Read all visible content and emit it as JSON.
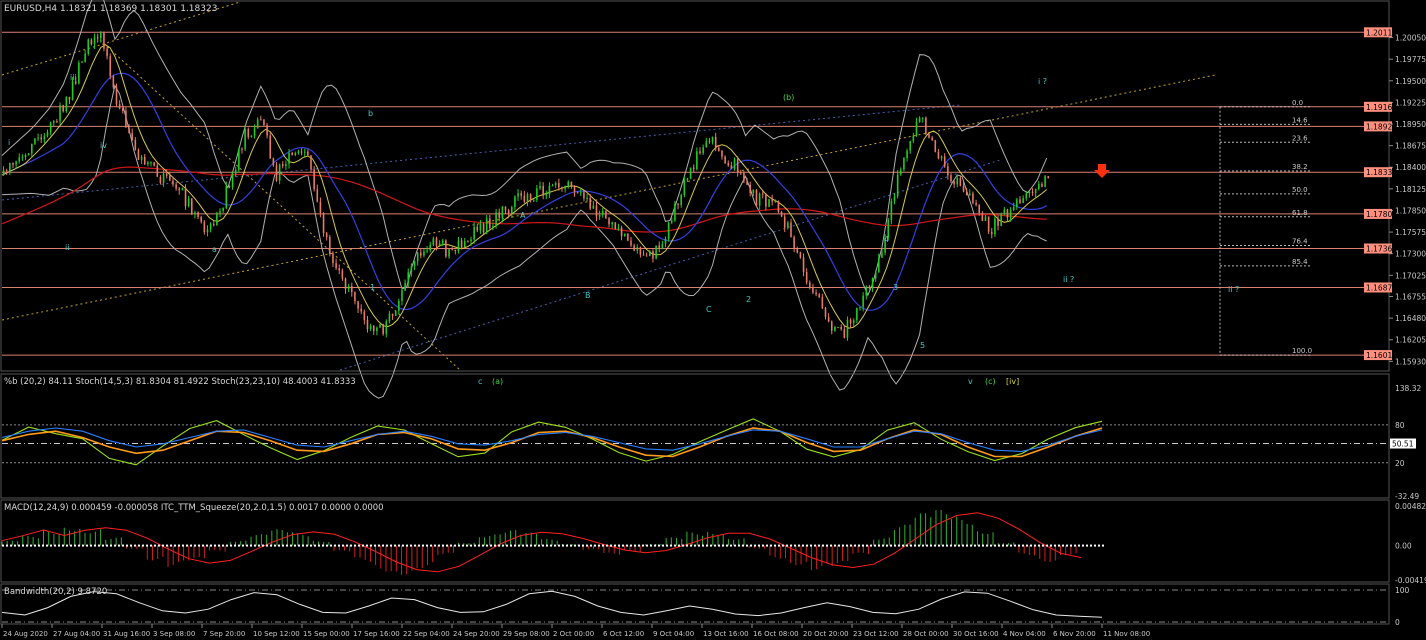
{
  "header": {
    "symbol_line": "EURUSD,H4  1.18321 1.18369 1.18301 1.18323"
  },
  "colors": {
    "background": "#000000",
    "bull": "#22cc22",
    "bear": "#e87a66",
    "hline": "#d98070",
    "bb": "#b0b0b0",
    "ma_fast": "#d8c94a",
    "ma_mid": "#3340e0",
    "ma_slow": "#d01818",
    "fib": "#b8b8b8",
    "stoch_fast": "#9adf1c",
    "stoch_slow": "#ff9a1a",
    "pctb": "#2a7fff",
    "macd_pos": "#2fb02f",
    "macd_neg": "#d02020",
    "macd_signal": "#ff2020"
  },
  "chart_data": [
    {
      "name": "EURUSD,H4",
      "type": "line",
      "ohlc_last": {
        "open": 1.18321,
        "high": 1.18369,
        "low": 1.18301,
        "close": 1.18323
      },
      "y_ticks": [
        "1.20050",
        "1.19775",
        "1.19500",
        "1.19225",
        "1.18950",
        "1.18675",
        "1.18400",
        "1.18125",
        "1.17850",
        "1.17575",
        "1.17300",
        "1.17025",
        "1.16755",
        "1.16480",
        "1.16205",
        "1.15930"
      ],
      "y_range": [
        1.1582,
        1.2035
      ],
      "price_levels": [
        {
          "label": "1.20117",
          "value": 1.20117
        },
        {
          "label": "1.19169",
          "value": 1.19169
        },
        {
          "label": "1.18920",
          "value": 1.1892
        },
        {
          "label": "1.18337",
          "value": 1.18337
        },
        {
          "label": "1.17806",
          "value": 1.17806
        },
        {
          "label": "1.17366",
          "value": 1.17366
        },
        {
          "label": "1.16870",
          "value": 1.1687
        },
        {
          "label": "1.16010",
          "value": 1.1601
        }
      ],
      "current_price_label": "1.18337",
      "fib_levels": [
        {
          "label": "0.0",
          "value": 1.19169
        },
        {
          "label": "14.6",
          "value": 1.18946
        },
        {
          "label": "23.6",
          "value": 1.18718
        },
        {
          "label": "38.2",
          "value": 1.18352
        },
        {
          "label": "50.0",
          "value": 1.18061
        },
        {
          "label": "61.8",
          "value": 1.1777
        },
        {
          "label": "76.4",
          "value": 1.17404
        },
        {
          "label": "85.4",
          "value": 1.17145
        },
        {
          "label": "100.0",
          "value": 1.1601
        }
      ],
      "price_path": [
        [
          0,
          1.183
        ],
        [
          20,
          1.1868
        ],
        [
          40,
          1.1918
        ],
        [
          55,
          1.1995
        ],
        [
          62,
          1.201
        ],
        [
          72,
          1.1935
        ],
        [
          85,
          1.186
        ],
        [
          100,
          1.183
        ],
        [
          115,
          1.1805
        ],
        [
          130,
          1.176
        ],
        [
          140,
          1.179
        ],
        [
          155,
          1.188
        ],
        [
          165,
          1.19
        ],
        [
          175,
          1.183
        ],
        [
          185,
          1.186
        ],
        [
          195,
          1.185
        ],
        [
          205,
          1.176
        ],
        [
          212,
          1.172
        ],
        [
          222,
          1.168
        ],
        [
          232,
          1.164
        ],
        [
          242,
          1.1632
        ],
        [
          250,
          1.166
        ],
        [
          262,
          1.172
        ],
        [
          275,
          1.175
        ],
        [
          285,
          1.173
        ],
        [
          300,
          1.1755
        ],
        [
          315,
          1.1775
        ],
        [
          330,
          1.18
        ],
        [
          345,
          1.181
        ],
        [
          360,
          1.182
        ],
        [
          375,
          1.179
        ],
        [
          390,
          1.177
        ],
        [
          400,
          1.1745
        ],
        [
          410,
          1.172
        ],
        [
          420,
          1.174
        ],
        [
          432,
          1.18
        ],
        [
          442,
          1.185
        ],
        [
          452,
          1.188
        ],
        [
          460,
          1.1855
        ],
        [
          470,
          1.1835
        ],
        [
          480,
          1.18
        ],
        [
          492,
          1.1795
        ],
        [
          502,
          1.176
        ],
        [
          512,
          1.17
        ],
        [
          520,
          1.167
        ],
        [
          528,
          1.164
        ],
        [
          535,
          1.1625
        ],
        [
          545,
          1.166
        ],
        [
          555,
          1.17
        ],
        [
          562,
          1.1735
        ],
        [
          570,
          1.182
        ],
        [
          578,
          1.1865
        ],
        [
          585,
          1.19
        ],
        [
          592,
          1.188
        ],
        [
          600,
          1.184
        ],
        [
          610,
          1.182
        ],
        [
          620,
          1.18
        ],
        [
          630,
          1.176
        ],
        [
          640,
          1.178
        ],
        [
          650,
          1.18
        ],
        [
          660,
          1.181
        ],
        [
          668,
          1.1833
        ]
      ],
      "wave_labels": [
        "iii",
        "iv",
        "ii",
        "i",
        "a",
        "b",
        "c",
        "(a)",
        "(b)",
        "A",
        "B",
        "C",
        "1",
        "2",
        "3",
        "4",
        "5",
        "v",
        "(c)",
        "[iv]",
        "i ?",
        "ii ?"
      ]
    },
    {
      "name": "%b (20,2) 84.11  Stoch(14,5,3) 81.8304 81.4922  Stoch(23,23,10) 48.4003 41.8333",
      "type": "line",
      "y_ticks": [
        "138.32",
        "80",
        "50.51",
        "20",
        "-32.49"
      ],
      "y_range": [
        -32.49,
        138.32
      ],
      "last_value_label": "50.51",
      "series": [
        {
          "name": "Stoch(14,5,3)",
          "values": [
            60,
            80,
            70,
            55,
            30,
            20,
            45,
            70,
            85,
            60,
            40,
            25,
            35,
            60,
            80,
            70,
            50,
            30,
            40,
            65,
            80,
            75,
            55,
            35,
            20,
            30,
            55,
            75,
            85,
            65,
            40,
            25,
            40,
            70,
            82,
            60,
            35,
            20,
            30,
            60,
            80,
            82
          ]
        },
        {
          "name": "Stoch(23,23,10)",
          "values": [
            55,
            65,
            70,
            60,
            45,
            35,
            40,
            55,
            70,
            68,
            55,
            40,
            38,
            50,
            65,
            68,
            58,
            42,
            40,
            52,
            68,
            70,
            60,
            45,
            32,
            30,
            45,
            62,
            75,
            70,
            52,
            38,
            40,
            58,
            72,
            65,
            45,
            30,
            30,
            45,
            62,
            75
          ]
        },
        {
          "name": "%b",
          "values": [
            60,
            70,
            75,
            70,
            55,
            45,
            50,
            60,
            70,
            72,
            60,
            48,
            45,
            55,
            65,
            70,
            62,
            50,
            48,
            55,
            65,
            68,
            62,
            52,
            42,
            40,
            50,
            62,
            72,
            70,
            58,
            45,
            45,
            58,
            70,
            66,
            52,
            40,
            38,
            48,
            62,
            72
          ]
        }
      ]
    },
    {
      "name": "MACD(12,24,9) 0.000459 -0.000058  ITC_TTM_Squeeze(20,2.0,1.5) 0.0017 0.0000 0.0000",
      "type": "bar",
      "y_ticks": [
        "0.004825",
        "0.00",
        "-0.004194"
      ],
      "y_range": [
        -0.004194,
        0.004825
      ],
      "values": [
        0.0006,
        0.0012,
        0.0019,
        0.0025,
        0.0021,
        0.001,
        -0.0004,
        -0.0018,
        -0.0026,
        -0.002,
        -0.0008,
        0.0006,
        0.0014,
        0.002,
        0.0016,
        0.0006,
        -0.0008,
        -0.002,
        -0.0032,
        -0.0036,
        -0.0028,
        -0.0012,
        0.0004,
        0.0014,
        0.0019,
        0.0016,
        0.0008,
        0.0002,
        -0.0006,
        -0.0012,
        -0.0008,
        0.0002,
        0.001,
        0.0017,
        0.0018,
        0.001,
        -0.0004,
        -0.0016,
        -0.0024,
        -0.003,
        -0.0026,
        -0.0012,
        0.001,
        0.0026,
        0.004,
        0.0044,
        0.0036,
        0.002,
        0.0004,
        -0.0012,
        -0.002,
        -0.0012,
        0.0
      ]
    },
    {
      "name": "Bandwidth(20,2) 9.8720",
      "type": "line",
      "y_ticks": [
        "100",
        "0"
      ],
      "y_range": [
        0,
        100
      ],
      "values": [
        30,
        22,
        45,
        80,
        95,
        88,
        60,
        35,
        28,
        40,
        70,
        92,
        85,
        55,
        30,
        28,
        50,
        75,
        70,
        45,
        30,
        32,
        55,
        88,
        96,
        80,
        50,
        30,
        22,
        35,
        50,
        40,
        25,
        20,
        28,
        45,
        60,
        48,
        30,
        26,
        40,
        72,
        94,
        90,
        65,
        38,
        22,
        18,
        15
      ]
    }
  ],
  "x_axis": {
    "labels": [
      "24 Aug 2020",
      "27 Aug 04:00",
      "31 Aug 16:00",
      "3 Sep 08:00",
      "7 Sep 20:00",
      "10 Sep 12:00",
      "15 Sep 00:00",
      "17 Sep 16:00",
      "22 Sep 04:00",
      "24 Sep 20:00",
      "29 Sep 08:00",
      "2 Oct 00:00",
      "6 Oct 12:00",
      "9 Oct 04:00",
      "13 Oct 16:00",
      "16 Oct 08:00",
      "20 Oct 20:00",
      "23 Oct 12:00",
      "28 Oct 00:00",
      "30 Oct 16:00",
      "4 Nov 04:00",
      "6 Nov 20:00",
      "11 Nov 08:00"
    ]
  }
}
